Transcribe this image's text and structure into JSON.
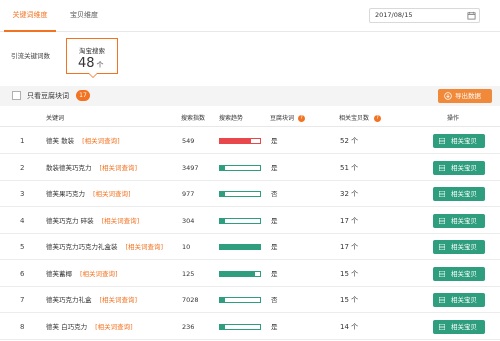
{
  "tabs": [
    {
      "label": "关键词维度",
      "active": true
    },
    {
      "label": "宝贝维度",
      "active": false
    }
  ],
  "date": {
    "value": "2017/08/15",
    "icon": "calendar-icon"
  },
  "source": {
    "label": "引流关键词数",
    "card_title": "淘宝搜索",
    "card_count": "48",
    "card_unit": "个"
  },
  "filter": {
    "checkbox_label": "只看豆腐块词",
    "badge_count": "17",
    "export_label": "导出数据",
    "export_icon": "download-icon"
  },
  "colors": {
    "accent": "#f27321",
    "green": "#2e9e7e",
    "red": "#e8474c"
  },
  "table": {
    "headers": {
      "keyword": "关键词",
      "search_index": "搜索指数",
      "trend": "搜索趋势",
      "tofu": "豆腐块词",
      "related_count": "相关宝贝数",
      "action": "操作"
    },
    "rows": [
      {
        "index": "1",
        "keyword": "德芙 散装",
        "link": "[相关词查询]",
        "search_index": "549",
        "trend_fraction": 0.78,
        "trend_color": "red",
        "tofu": "是",
        "related": "52",
        "unit": "个",
        "action": "相关宝贝"
      },
      {
        "index": "2",
        "keyword": "散装德芙巧克力",
        "link": "[相关词查询]",
        "search_index": "3497",
        "trend_fraction": 0.12,
        "trend_color": "green",
        "tofu": "是",
        "related": "51",
        "unit": "个",
        "action": "相关宝贝"
      },
      {
        "index": "3",
        "keyword": "德芙果巧克力",
        "link": "[相关词查询]",
        "search_index": "977",
        "trend_fraction": 0.12,
        "trend_color": "green",
        "tofu": "否",
        "related": "32",
        "unit": "个",
        "action": "相关宝贝"
      },
      {
        "index": "4",
        "keyword": "德芙巧克力 碎装",
        "link": "[相关词查询]",
        "search_index": "304",
        "trend_fraction": 0.12,
        "trend_color": "green",
        "tofu": "是",
        "related": "17",
        "unit": "个",
        "action": "相关宝贝"
      },
      {
        "index": "5",
        "keyword": "德芙巧克力巧克力礼盒装",
        "link": "[相关词查询]",
        "search_index": "10",
        "trend_fraction": 1.0,
        "trend_color": "green",
        "tofu": "是",
        "related": "17",
        "unit": "个",
        "action": "相关宝贝"
      },
      {
        "index": "6",
        "keyword": "德芙蓄椰",
        "link": "[相关词查询]",
        "search_index": "125",
        "trend_fraction": 0.88,
        "trend_color": "green",
        "tofu": "是",
        "related": "15",
        "unit": "个",
        "action": "相关宝贝"
      },
      {
        "index": "7",
        "keyword": "德芙巧克力礼盒",
        "link": "[相关词查询]",
        "search_index": "7028",
        "trend_fraction": 0.12,
        "trend_color": "green",
        "tofu": "否",
        "related": "15",
        "unit": "个",
        "action": "相关宝贝"
      },
      {
        "index": "8",
        "keyword": "德芙 白巧克力",
        "link": "[相关词查询]",
        "search_index": "236",
        "trend_fraction": 0.12,
        "trend_color": "green",
        "tofu": "是",
        "related": "14",
        "unit": "个",
        "action": "相关宝贝"
      }
    ]
  }
}
